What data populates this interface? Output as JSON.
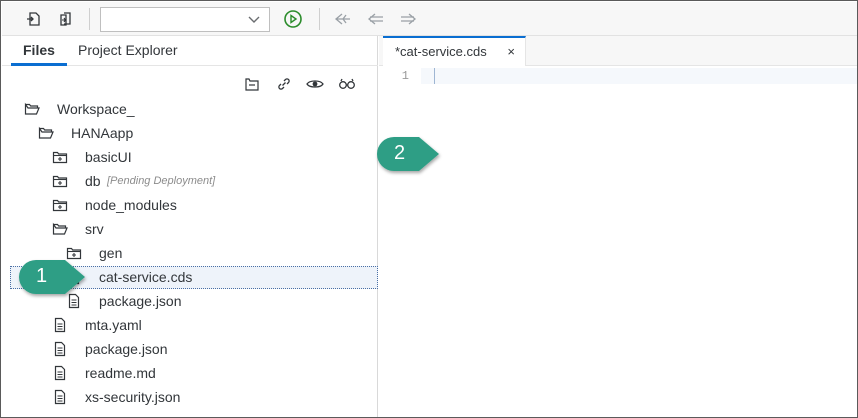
{
  "toolbar": {
    "run_selector_value": "",
    "icons": [
      "new-file-icon",
      "import-icon",
      "chevron-down-icon",
      "run-icon",
      "previous-change-icon",
      "back-icon",
      "forward-icon"
    ]
  },
  "left_panel": {
    "tabs": [
      {
        "label": "Files",
        "active": true
      },
      {
        "label": "Project Explorer",
        "active": false
      }
    ],
    "actions": [
      "collapse-all-icon",
      "link-icon",
      "show-hidden-icon",
      "search-icon"
    ],
    "tree": [
      {
        "label": "Workspace_",
        "type": "folder-open",
        "depth": 0
      },
      {
        "label": "HANAapp",
        "type": "folder-open",
        "depth": 1
      },
      {
        "label": "basicUI",
        "type": "folder-closed",
        "depth": 2
      },
      {
        "label": "db",
        "note": "[Pending Deployment]",
        "type": "folder-closed",
        "depth": 2
      },
      {
        "label": "node_modules",
        "type": "folder-closed",
        "depth": 2
      },
      {
        "label": "srv",
        "type": "folder-open",
        "depth": 2
      },
      {
        "label": "gen",
        "type": "folder-closed",
        "depth": 3
      },
      {
        "label": "cat-service.cds",
        "type": "file",
        "depth": 3,
        "selected": true
      },
      {
        "label": "package.json",
        "type": "file",
        "depth": 3
      },
      {
        "label": "mta.yaml",
        "type": "file",
        "depth": 2
      },
      {
        "label": "package.json",
        "type": "file",
        "depth": 2
      },
      {
        "label": "readme.md",
        "type": "file",
        "depth": 2
      },
      {
        "label": "xs-security.json",
        "type": "file",
        "depth": 2
      }
    ]
  },
  "editor": {
    "tab_label": "*cat-service.cds",
    "close_label": "×",
    "line_numbers": [
      "1"
    ]
  },
  "callouts": [
    {
      "label": "1",
      "color": "#2e9e85"
    },
    {
      "label": "2",
      "color": "#2e9e85"
    }
  ],
  "colors": {
    "accent": "#0a6ed1",
    "run": "#2b8c2b",
    "callout": "#2e9e85"
  }
}
